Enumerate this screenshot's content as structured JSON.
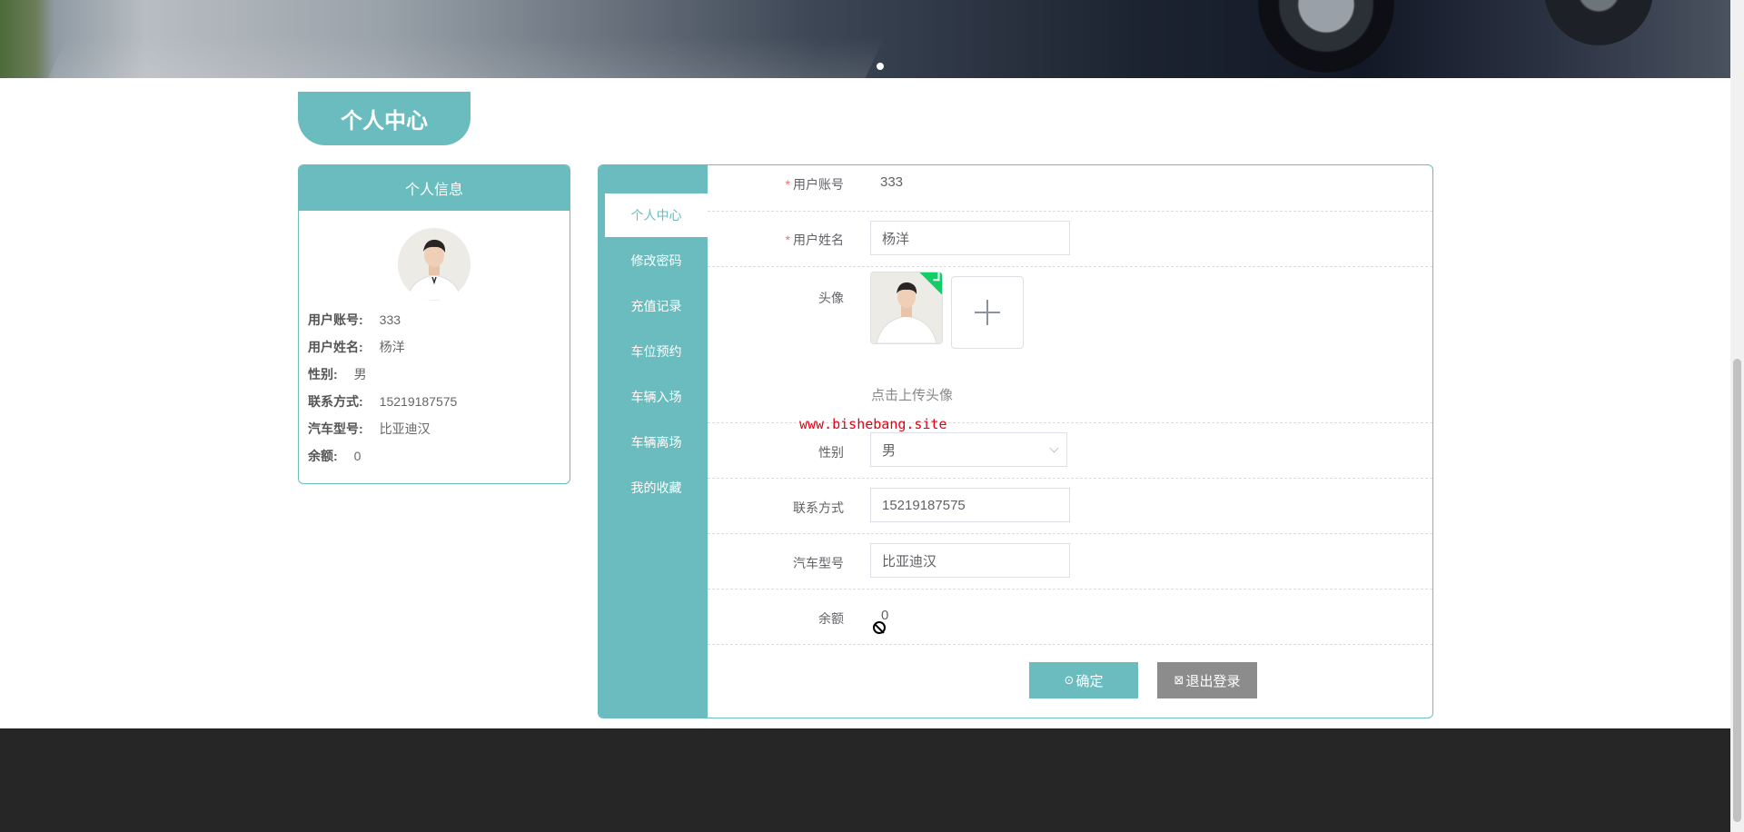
{
  "banner": {
    "slide_count": 1,
    "active_slide": 1
  },
  "page_title": "个人中心",
  "info_card": {
    "title": "个人信息",
    "rows": [
      {
        "label": "用户账号:",
        "value": "333"
      },
      {
        "label": "用户姓名:",
        "value": "杨洋"
      },
      {
        "label": "性别:",
        "value": "男"
      },
      {
        "label": "联系方式:",
        "value": "15219187575"
      },
      {
        "label": "汽车型号:",
        "value": "比亚迪汉"
      },
      {
        "label": "余额:",
        "value": "0"
      }
    ]
  },
  "tabs": [
    "个人中心",
    "修改密码",
    "充值记录",
    "车位预约",
    "车辆入场",
    "车辆离场",
    "我的收藏"
  ],
  "active_tab": "个人中心",
  "form": {
    "account_label": "用户账号",
    "account_value": "333",
    "name_label": "用户姓名",
    "name_value": "杨洋",
    "avatar_label": "头像",
    "avatar_tip": "点击上传头像",
    "gender_label": "性别",
    "gender_value": "男",
    "phone_label": "联系方式",
    "phone_value": "15219187575",
    "car_label": "汽车型号",
    "car_value": "比亚迪汉",
    "balance_label": "余额",
    "balance_value": "0",
    "required_mark": "*"
  },
  "buttons": {
    "confirm": "确定",
    "logout": "退出登录"
  },
  "watermark": "www.bishebang.site",
  "colors": {
    "accent": "#6bbcbe",
    "logout": "#8c8c8c",
    "footer": "#262626",
    "watermark": "#e60012"
  },
  "icons": {
    "confirm": "check-circle-icon",
    "logout": "close-box-icon",
    "upload": "plus-icon",
    "cursor": "not-allowed-cursor-icon"
  }
}
